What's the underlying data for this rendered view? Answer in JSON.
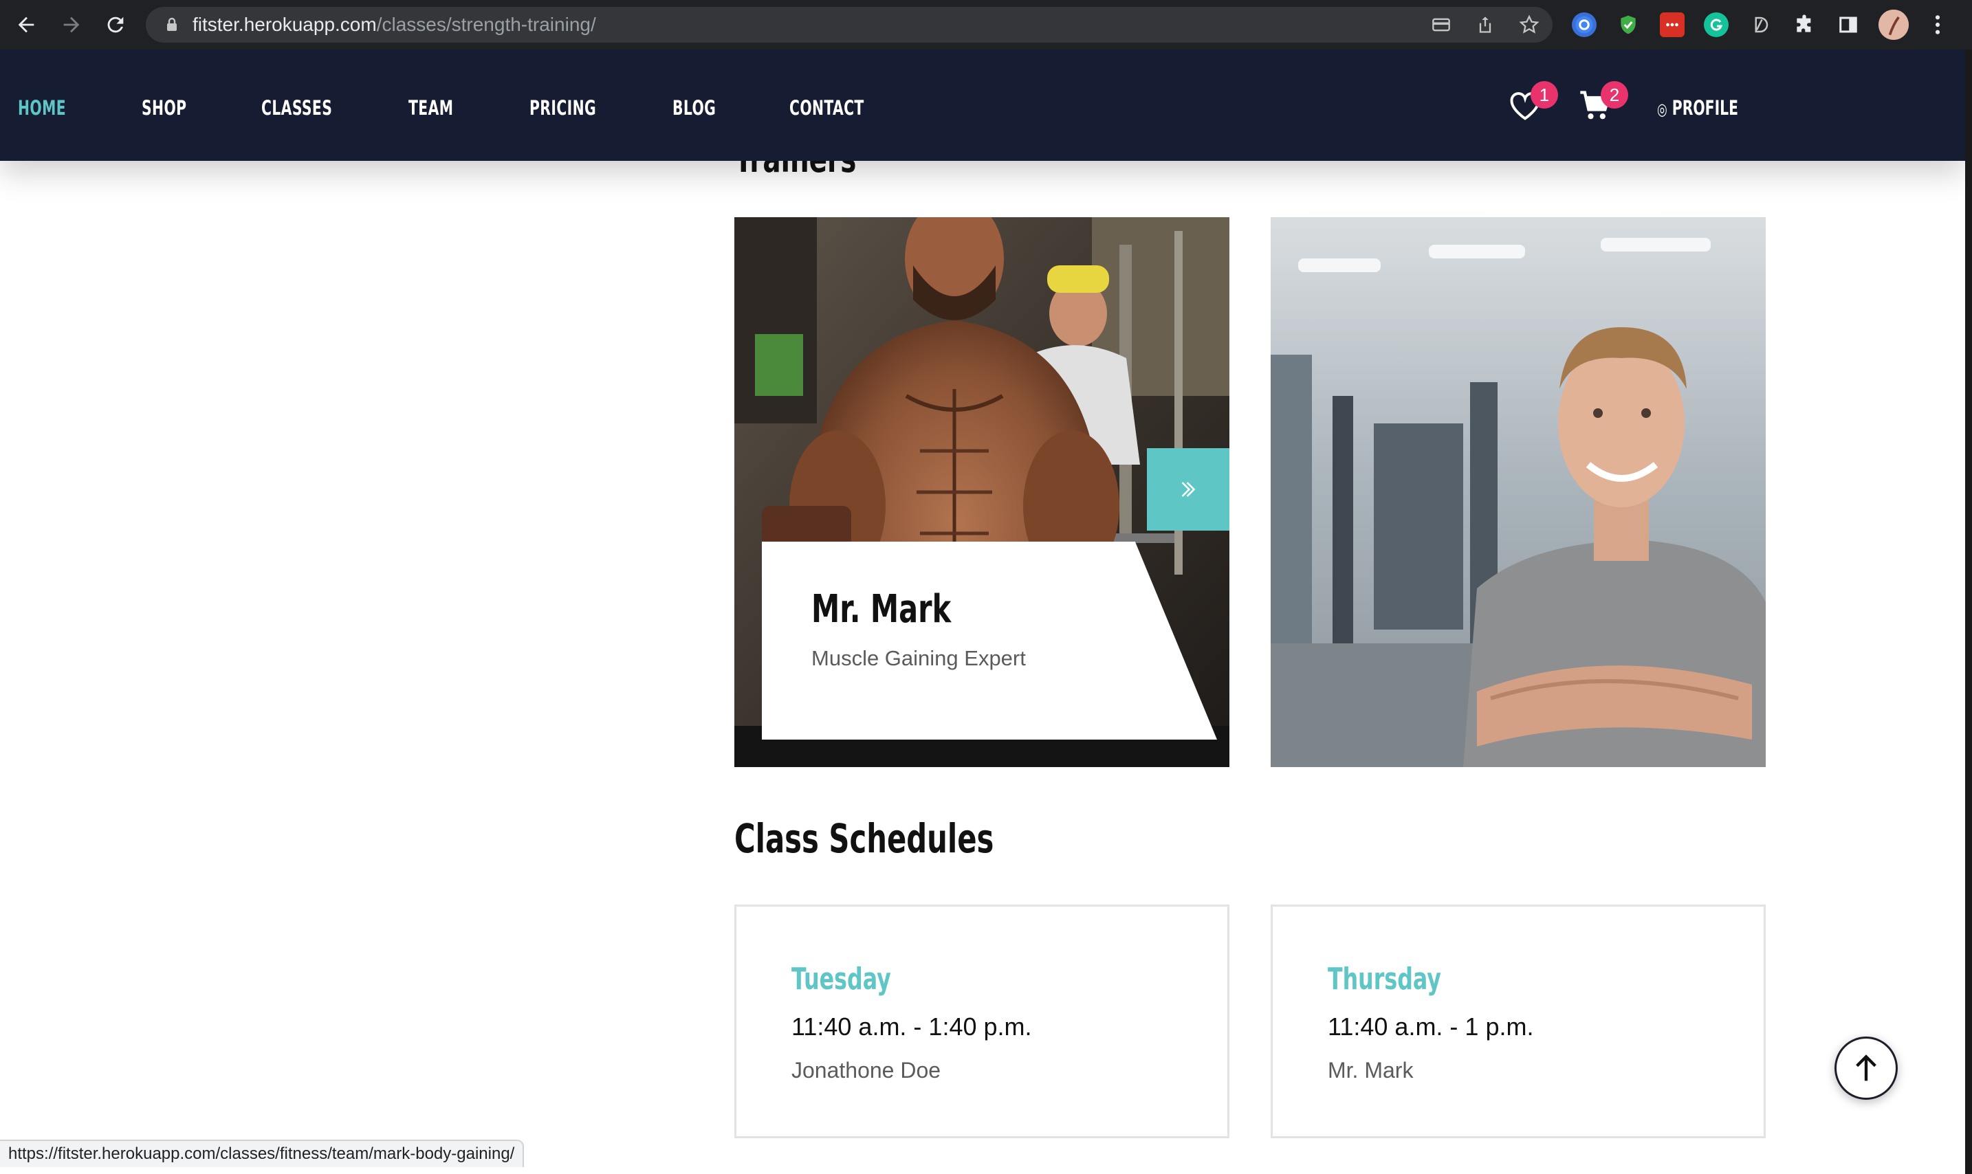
{
  "browser": {
    "url_domain": "fitster.herokuapp.com",
    "url_path": "/classes/strength-training/",
    "status_url": "https://fitster.herokuapp.com/classes/fitness/team/mark-body-gaining/"
  },
  "nav": {
    "items": [
      {
        "label": "HOME",
        "active": true
      },
      {
        "label": "SHOP"
      },
      {
        "label": "CLASSES"
      },
      {
        "label": "TEAM"
      },
      {
        "label": "PRICING"
      },
      {
        "label": "BLOG"
      },
      {
        "label": "CONTACT"
      }
    ],
    "wishlist_count": "1",
    "cart_count": "2",
    "profile_label": "PROFILE"
  },
  "trainers_section": {
    "title": "Trainers",
    "cards": [
      {
        "name": "Mr. Mark",
        "role": "Muscle Gaining Expert"
      },
      {
        "name": "",
        "role": ""
      }
    ]
  },
  "schedules": {
    "title": "Class Schedules",
    "items": [
      {
        "day": "Tuesday",
        "time": "11:40 a.m. - 1:40 p.m.",
        "trainer": "Jonathone Doe"
      },
      {
        "day": "Thursday",
        "time": "11:40 a.m. - 1 p.m.",
        "trainer": "Mr. Mark"
      }
    ]
  },
  "colors": {
    "header_bg": "#161d33",
    "accent": "#5ec6c4",
    "badge": "#e8336d"
  },
  "icons": [
    "back-icon",
    "forward-icon",
    "reload-icon",
    "lock-icon",
    "heart-icon",
    "cart-icon",
    "chevrons-right-icon",
    "arrow-up-icon"
  ]
}
